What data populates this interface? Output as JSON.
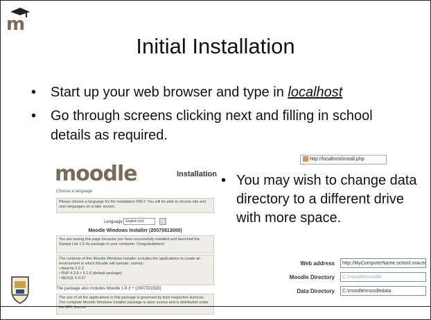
{
  "slide": {
    "title": "Initial Installation",
    "bullets": [
      {
        "text_before": "Start up your web browser and type in ",
        "link": "localhost"
      },
      {
        "text": "Go through screens clicking next and filling in school details as required."
      }
    ],
    "bullet_right": "You may wish to change data directory to a different drive with more space.",
    "bullet_char": "•"
  },
  "browser": {
    "url": "http://localhost/install.php"
  },
  "moodle_screenshot": {
    "logo": "moodle",
    "heading": "Installation",
    "choose_language": "Choose a language",
    "intro_text": "Please choose a language for the installation ONLY. You will be able to choose site and user languages on a later screen.",
    "language_label": "Language",
    "language_value": "English (en)",
    "windows_title": "Moodle Windows Installer (20070813000)",
    "para1": "You are seeing this page because you have successfully installed and launched the Xampp Lite 1.5.4a package in your computer. Congratulations!",
    "para2": "The contents of this Moodle Windows Installer includes the applications to create an environment in which Moodle will operate, namely:",
    "components": [
      "Apache 2.2.3",
      "PHP 4.3.8 + 5.1.6 (default package)",
      "MySQL 5.0.27"
    ],
    "package_line": "The package also includes Moodle 1.8.3 + (2007021532)",
    "para3": "The use of all the applications in this package is governed by their respective licences. The complete Moodle Windows Installer package is open source and is distributed under the GPL licence."
  },
  "dirs": {
    "web_address_label": "Web address",
    "web_address_value": "http://MyComputerName.school.nsw.edu.au",
    "moodle_dir_label": "Moodle Directory",
    "moodle_dir_value": "C:\\moodle\\moodle",
    "data_dir_label": "Data Directory",
    "data_dir_value": "C:\\moodle\\moodledata"
  }
}
